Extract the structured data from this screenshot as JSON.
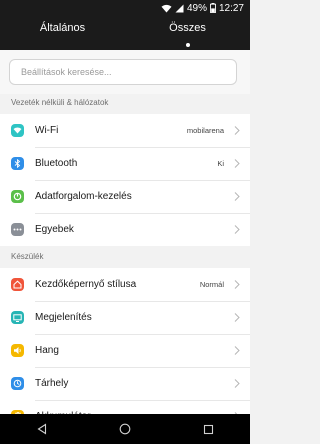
{
  "status": {
    "battery": "49%",
    "time": "12:27"
  },
  "tabs": [
    {
      "label": "Általános"
    },
    {
      "label": "Összes"
    }
  ],
  "search": {
    "placeholder": "Beállítások keresése..."
  },
  "sections": [
    {
      "title": "Vezeték nélküli & hálózatok",
      "items": [
        {
          "label": "Wi-Fi",
          "value": "mobilarena",
          "icon": "wifi-icon",
          "color": "#2ec4c4"
        },
        {
          "label": "Bluetooth",
          "value": "Ki",
          "icon": "bluetooth-icon",
          "color": "#2f8ee8"
        },
        {
          "label": "Adatforgalom-kezelés",
          "value": "",
          "icon": "data-usage-icon",
          "color": "#5bbf4a"
        },
        {
          "label": "Egyebek",
          "value": "",
          "icon": "more-icon",
          "color": "#8a8f97"
        }
      ]
    },
    {
      "title": "Készülék",
      "items": [
        {
          "label": "Kezdőképernyő stílusa",
          "value": "Normál",
          "icon": "home-icon",
          "color": "#f0553a"
        },
        {
          "label": "Megjelenítés",
          "value": "",
          "icon": "display-icon",
          "color": "#27b5b5"
        },
        {
          "label": "Hang",
          "value": "",
          "icon": "sound-icon",
          "color": "#f5b800"
        },
        {
          "label": "Tárhely",
          "value": "",
          "icon": "storage-icon",
          "color": "#2f8ee8"
        },
        {
          "label": "Akkumulátor",
          "value": "",
          "icon": "battery-icon",
          "color": "#f5b800"
        }
      ]
    }
  ]
}
